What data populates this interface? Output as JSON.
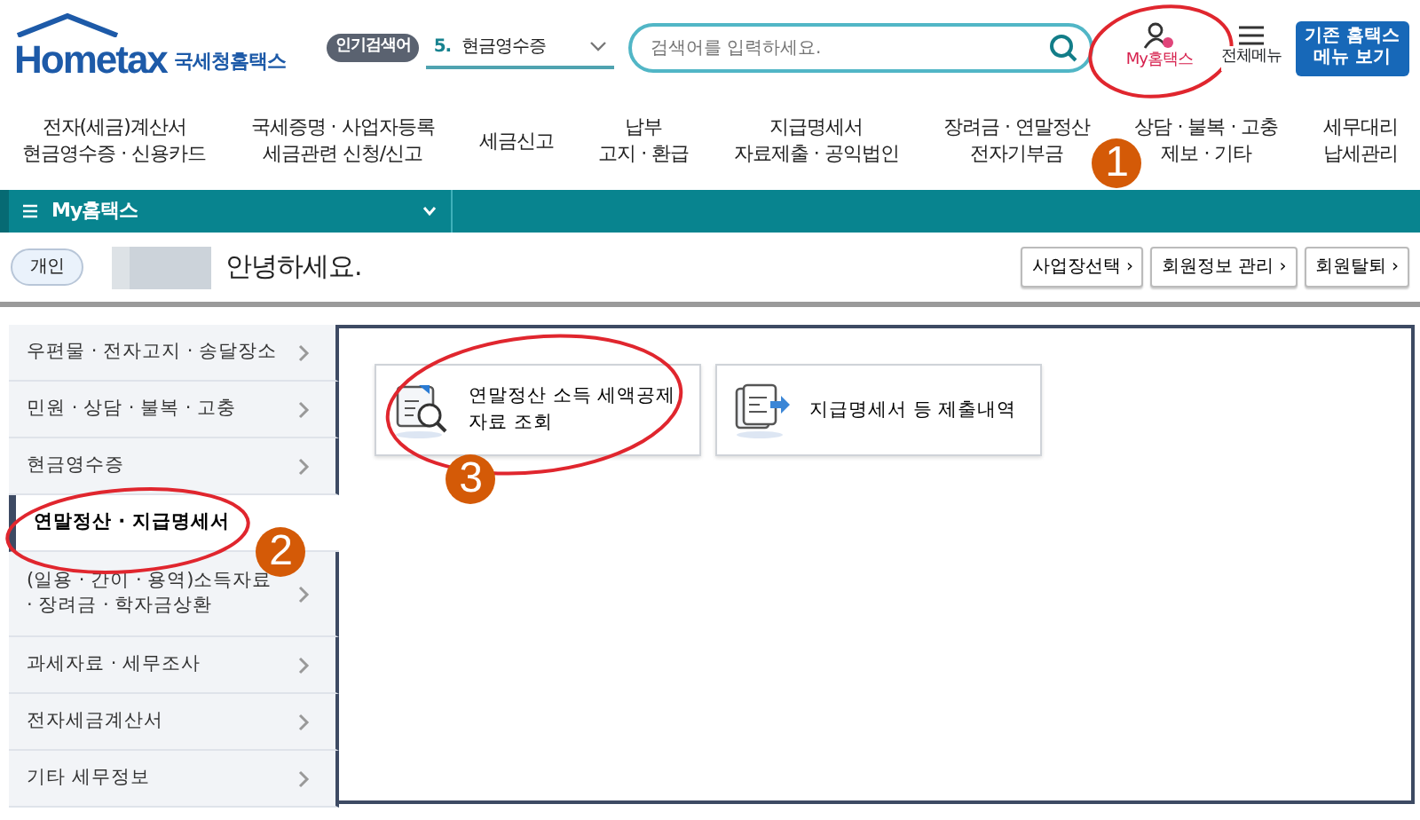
{
  "header": {
    "logo": {
      "name": "Hometax",
      "subtitle": "국세청홈택스"
    },
    "popular_search": {
      "label": "인기검색어",
      "rank": "5.",
      "term": "현금영수증"
    },
    "search": {
      "placeholder": "검색어를 입력하세요."
    },
    "my_hometax": "My홈택스",
    "all_menu": "전체메뉴",
    "classic_button": "기존 홈택스 메뉴 보기"
  },
  "nav": [
    {
      "lines": [
        "전자(세금)계산서",
        "현금영수증 · 신용카드"
      ]
    },
    {
      "lines": [
        "국세증명 · 사업자등록",
        "세금관련 신청/신고"
      ]
    },
    {
      "lines": [
        "세금신고"
      ]
    },
    {
      "lines": [
        "납부",
        "고지 · 환급"
      ]
    },
    {
      "lines": [
        "지급명세서",
        "자료제출 · 공익법인"
      ]
    },
    {
      "lines": [
        "장려금 · 연말정산",
        "전자기부금"
      ]
    },
    {
      "lines": [
        "상담 · 불복 · 고충",
        "제보 · 기타"
      ]
    },
    {
      "lines": [
        "세무대리",
        "납세관리"
      ]
    }
  ],
  "breadcrumb": {
    "label": "My홈택스"
  },
  "user": {
    "type": "개인",
    "greeting": "안녕하세요.",
    "buttons": [
      "사업장선택 ›",
      "회원정보 관리 ›",
      "회원탈퇴 ›"
    ]
  },
  "sidebar": {
    "items": [
      {
        "label": "우편물 · 전자고지 · 송달장소",
        "selected": false
      },
      {
        "label": "민원 · 상담 · 불복 · 고충",
        "selected": false
      },
      {
        "label": "현금영수증",
        "selected": false
      },
      {
        "label": "연말정산 · 지급명세서",
        "selected": true
      },
      {
        "label": "(일용 · 간이 · 용역)소득자료 · 장려금 · 학자금상환",
        "selected": false
      },
      {
        "label": "과세자료 · 세무조사",
        "selected": false
      },
      {
        "label": "전자세금계산서",
        "selected": false
      },
      {
        "label": "기타 세무정보",
        "selected": false
      }
    ]
  },
  "cards": [
    {
      "label": "연말정산 소득 세액공제 자료 조회",
      "kind": "search"
    },
    {
      "label": "지급명세서 등 제출내역",
      "kind": "submit"
    }
  ],
  "annotations": [
    {
      "number": "1"
    },
    {
      "number": "2"
    },
    {
      "number": "3"
    }
  ]
}
